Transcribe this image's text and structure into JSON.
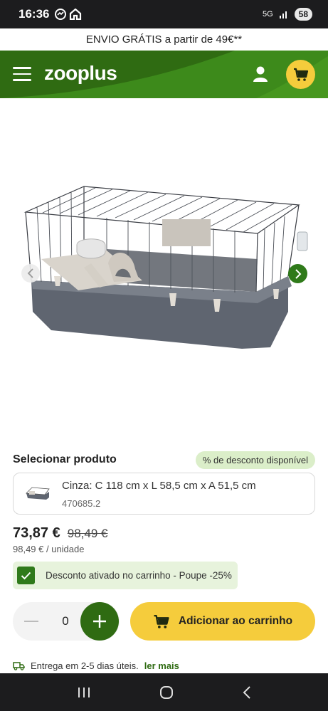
{
  "status": {
    "time": "16:36",
    "network": "5G",
    "battery": "58"
  },
  "promo": {
    "text": "ENVIO GRÁTIS a partir de 49€**"
  },
  "header": {
    "logo": "zooplus"
  },
  "product": {
    "select_title": "Selecionar produto",
    "discount_badge": "% de desconto disponível",
    "variant_name": "Cinza: C 118 cm x L 58,5 cm x A 51,5 cm",
    "variant_sku": "470685.2",
    "price_now": "73,87 €",
    "price_was": "98,49 €",
    "unit_price": "98,49 € / unidade",
    "deal_text": "Desconto ativado no carrinho - Poupe -25%"
  },
  "cart": {
    "quantity": "0",
    "add_label": "Adicionar ao carrinho"
  },
  "delivery": {
    "text": "Entrega em 2-5 dias úteis.",
    "link": "ler mais"
  },
  "colors": {
    "brand_green": "#2f6b12",
    "accent_yellow": "#f5cc3c"
  }
}
